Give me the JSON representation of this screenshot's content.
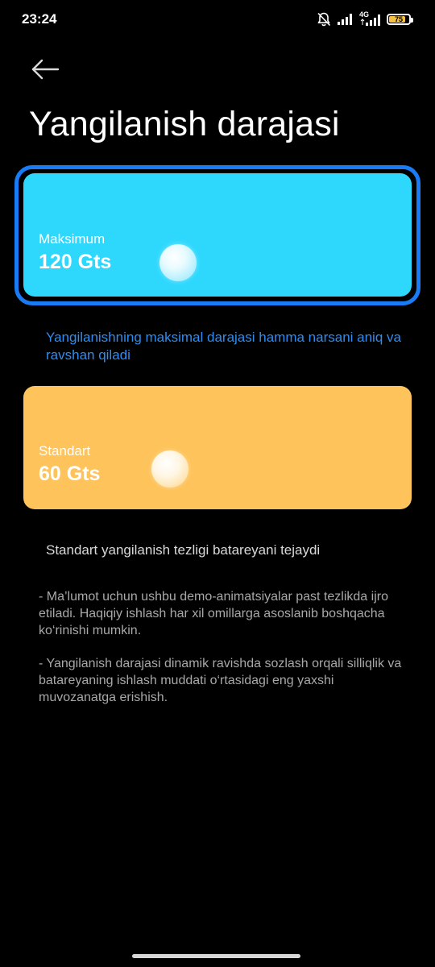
{
  "status_bar": {
    "time": "23:24",
    "network_label": "4G",
    "battery_level": "75",
    "battery_color": "#f5c244",
    "icons": [
      "bell-muted-icon",
      "signal-icon",
      "signal-4g-icon",
      "battery-icon"
    ]
  },
  "header": {
    "back_icon": "arrow-left-icon",
    "title": "Yangilanish darajasi"
  },
  "options": [
    {
      "label": "Maksimum",
      "value": "120 Gts",
      "selected": true,
      "color": "#2ed8fd",
      "description": "Yangilanishning maksimal darajasi hamma narsani aniq va ravshan qiladi"
    },
    {
      "label": "Standart",
      "value": "60 Gts",
      "selected": false,
      "color": "#fec35a",
      "description": "Standart yangilanish tezligi batareyani tejaydi"
    }
  ],
  "selection_ring_color": "#1a7cf5",
  "notes": [
    "- Ma’lumot uchun ushbu demo-animatsiyalar past tezlikda ijro etiladi. Haqiqiy ishlash har xil omillarga asoslanib boshqacha ko‘rinishi mumkin.",
    "- Yangilanish darajasi dinamik ravishda sozlash orqali silliqlik va batareyaning ishlash muddati o‘rtasidagi eng yaxshi muvozanatga erishish."
  ]
}
